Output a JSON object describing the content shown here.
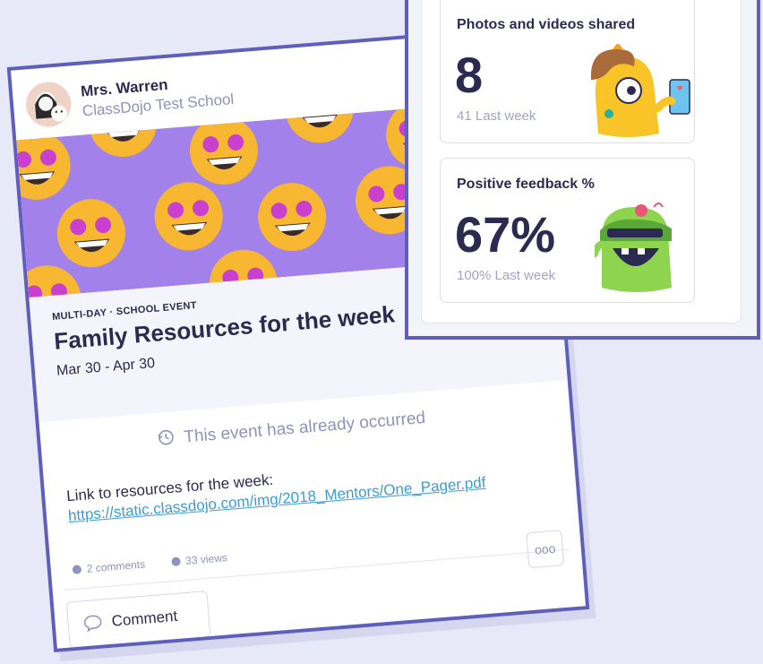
{
  "post": {
    "author": "Mrs. Warren",
    "school": "ClassDojo Test School",
    "event_type": "MULTI-DAY · SCHOOL EVENT",
    "title": "Family Resources for the week",
    "dates": "Mar 30 - Apr 30",
    "status": "This event has already occurred",
    "body_text": "Link to resources for the week:",
    "body_link": "https://static.classdojo.com/img/2018_Mentors/One_Pager.pdf",
    "comments": "2 comments",
    "views": "33 views",
    "more_label": "ooo",
    "comment_button": "Comment",
    "icons": {
      "avatar": "avatar-image",
      "status": "clock-history-icon",
      "comments": "comment-dot-icon",
      "views": "eye-check-icon",
      "comment": "speech-bubble-icon"
    }
  },
  "stats": {
    "cards": [
      {
        "title": "Photos and videos shared",
        "value": "8",
        "last_week": "41 Last week",
        "mascot": "yellow-monster-with-phone"
      },
      {
        "title": "Positive feedback %",
        "value": "67%",
        "last_week": "100% Last week",
        "mascot": "green-monster-laughing"
      }
    ]
  },
  "colors": {
    "accent_border": "#5e5fbd",
    "banner": "#a281ea",
    "link": "#3a9cd6",
    "text_dark": "#2c2a50",
    "text_muted": "#8f92be"
  }
}
